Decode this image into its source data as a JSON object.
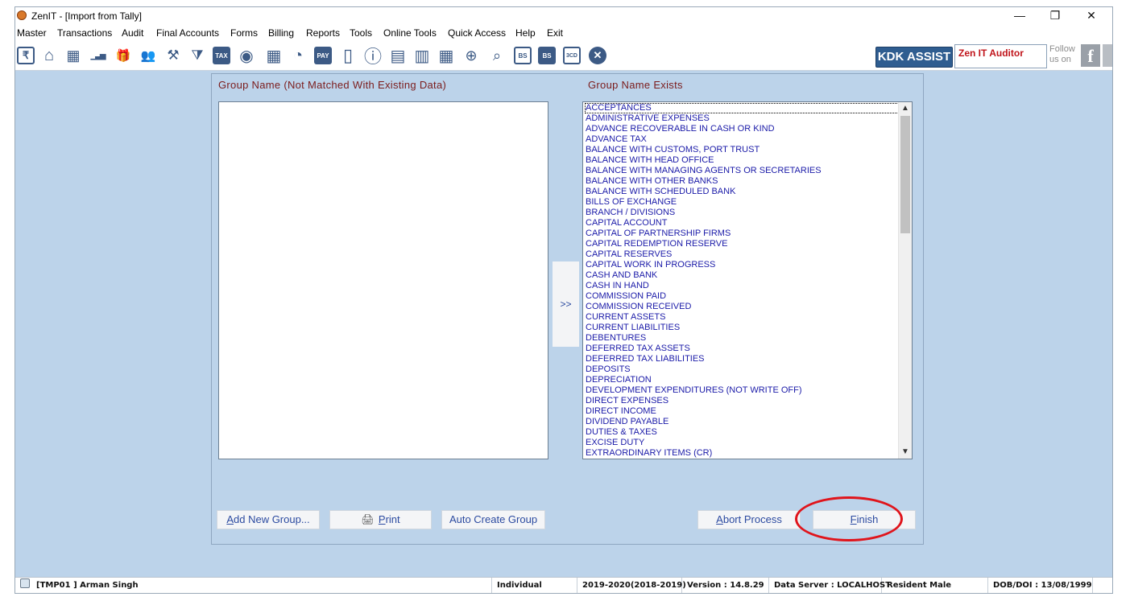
{
  "window": {
    "title": "ZenIT - [Import from Tally]",
    "controls": {
      "minimize": "—",
      "restore": "❐",
      "close": "✕"
    }
  },
  "menubar": {
    "items": [
      "Master",
      "Transactions",
      "Audit",
      "Final Accounts",
      "Forms",
      "Billing",
      "Reports",
      "Tools",
      "Online Tools",
      "Quick Access",
      "Help",
      "Exit"
    ]
  },
  "toolbar": {
    "icons": [
      {
        "name": "rupee-icon",
        "glyph": "₹"
      },
      {
        "name": "home-icon",
        "glyph": "⌂"
      },
      {
        "name": "building-icon",
        "glyph": "▦"
      },
      {
        "name": "bar-chart-icon",
        "glyph": "▁▃▅"
      },
      {
        "name": "gift-icon",
        "glyph": "🎁"
      },
      {
        "name": "users-icon",
        "glyph": "👥"
      },
      {
        "name": "gavel-icon",
        "glyph": "⚒"
      },
      {
        "name": "filter-icon",
        "glyph": "⧩"
      },
      {
        "name": "tax-icon",
        "glyph": "TAX"
      },
      {
        "name": "target-icon",
        "glyph": "◉"
      },
      {
        "name": "calculator-icon",
        "glyph": "▦"
      },
      {
        "name": "pie-chart-icon",
        "glyph": "◔"
      },
      {
        "name": "pay-icon",
        "glyph": "PAY"
      },
      {
        "name": "tablet-icon",
        "glyph": "▯"
      },
      {
        "name": "info-icon",
        "glyph": "ⓘ"
      },
      {
        "name": "spreadsheet-icon",
        "glyph": "▤"
      },
      {
        "name": "report-icon",
        "glyph": "▥"
      },
      {
        "name": "calendar-icon",
        "glyph": "▦"
      },
      {
        "name": "folder-add-icon",
        "glyph": "⊕"
      },
      {
        "name": "document-search-icon",
        "glyph": "⌕"
      },
      {
        "name": "bs-icon",
        "glyph": "BS"
      },
      {
        "name": "bs-sch-icon",
        "glyph": "BS"
      },
      {
        "name": "3cd-icon",
        "glyph": "3CD"
      },
      {
        "name": "close-circle-icon",
        "glyph": "✕"
      }
    ],
    "kdk_assist": "KDK ASSIST",
    "zen_it_auditor": "Zen IT Auditor",
    "follow_line1": "Follow",
    "follow_line2": "us on",
    "facebook": "f"
  },
  "left_panel": {
    "heading": "Group Name (Not Matched With Existing Data)",
    "items": []
  },
  "move_button": ">>",
  "right_panel": {
    "heading": "Group Name  Exists",
    "items": [
      "ACCEPTANCES",
      "ADMINISTRATIVE EXPENSES",
      "ADVANCE RECOVERABLE IN CASH OR KIND",
      "ADVANCE TAX",
      "BALANCE WITH CUSTOMS, PORT TRUST",
      "BALANCE WITH HEAD OFFICE",
      "BALANCE WITH MANAGING AGENTS OR SECRETARIES",
      "BALANCE WITH OTHER BANKS",
      "BALANCE WITH SCHEDULED BANK",
      "BILLS OF EXCHANGE",
      "BRANCH / DIVISIONS",
      "CAPITAL ACCOUNT",
      "CAPITAL OF PARTNERSHIP FIRMS",
      "CAPITAL REDEMPTION RESERVE",
      "CAPITAL RESERVES",
      "CAPITAL WORK IN PROGRESS",
      "CASH AND BANK",
      "CASH IN HAND",
      "COMMISSION PAID",
      "COMMISSION RECEIVED",
      "CURRENT ASSETS",
      "CURRENT LIABILITIES",
      "DEBENTURES",
      "DEFERRED TAX ASSETS",
      "DEFERRED TAX LIABILITIES",
      "DEPOSITS",
      "DEPRECIATION",
      "DEVELOPMENT EXPENDITURES (NOT WRITE OFF)",
      "DIRECT EXPENSES",
      "DIRECT INCOME",
      "DIVIDEND PAYABLE",
      "DUTIES & TAXES",
      "EXCISE DUTY",
      "EXTRAORDINARY ITEMS (CR)"
    ]
  },
  "buttons": {
    "add_new_group": "Add New Group...",
    "print": "Print",
    "auto_create_group": "Auto Create Group",
    "abort_process": "Abort Process",
    "finish": "Finish"
  },
  "statusbar": {
    "user": "[TMP01 ] Arman Singh",
    "type": "Individual",
    "year": "2019-2020(2018-2019)",
    "version": "Version : 14.8.29",
    "data_server": "Data Server : LOCALHOST",
    "resident": "Resident Male",
    "dob": "DOB/DOI : 13/08/1999"
  },
  "colors": {
    "background": "#bcd3ea",
    "heading": "#7b1c1c",
    "list_text": "#1a1aa8",
    "highlight": "#e0141b",
    "kdk": "#2f5d90"
  }
}
